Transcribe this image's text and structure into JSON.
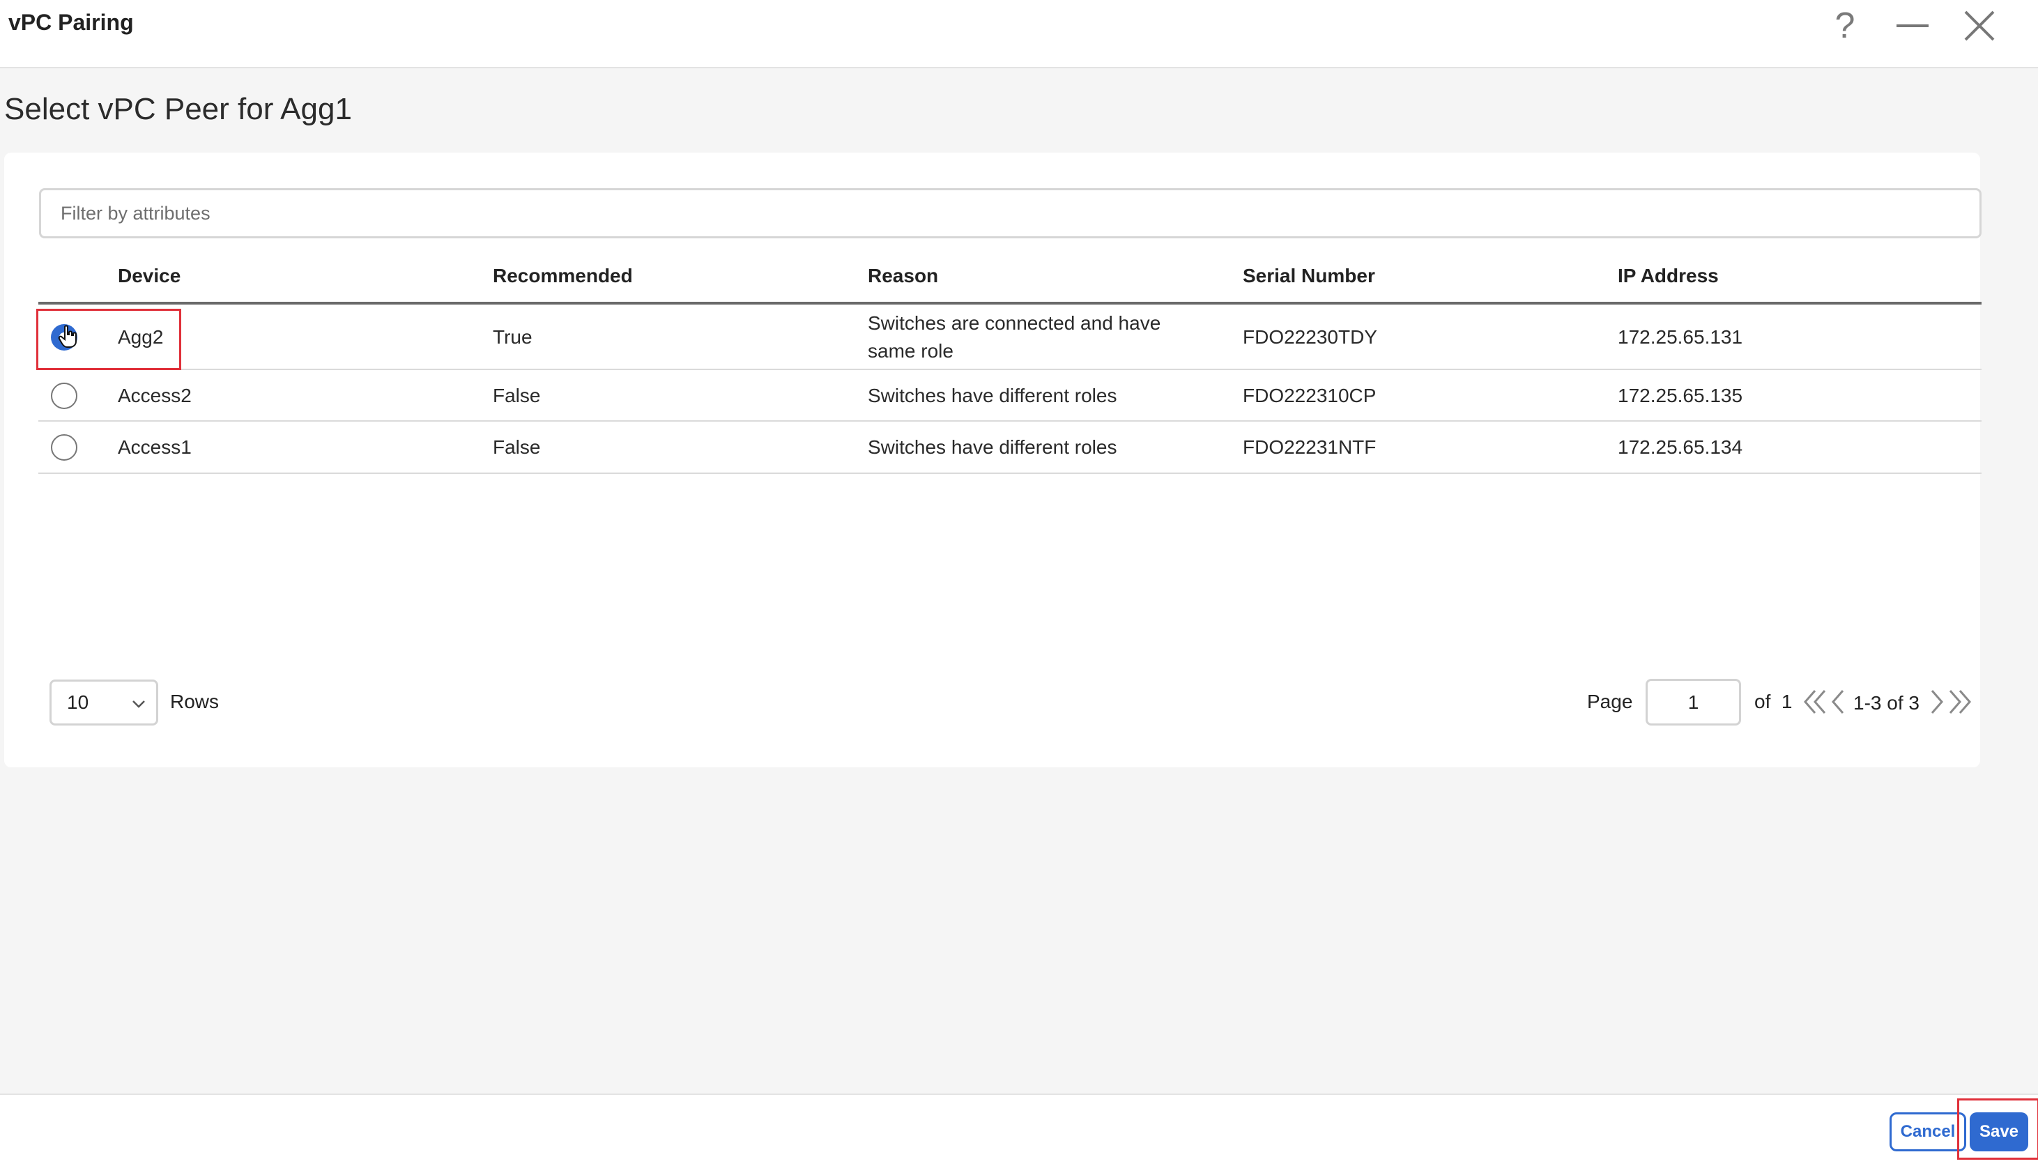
{
  "window": {
    "title": "vPC Pairing"
  },
  "page": {
    "title": "Select vPC Peer for Agg1"
  },
  "filter": {
    "placeholder": "Filter by attributes",
    "value": ""
  },
  "table": {
    "columns": [
      "Device",
      "Recommended",
      "Reason",
      "Serial Number",
      "IP Address"
    ],
    "rows": [
      {
        "selected": true,
        "device": "Agg2",
        "recommended": "True",
        "reason_line1": "Switches are connected and have",
        "reason_line2": "same role",
        "serial": "FDO22230TDY",
        "ip": "172.25.65.131"
      },
      {
        "selected": false,
        "device": "Access2",
        "recommended": "False",
        "reason_line1": "Switches have different roles",
        "serial": "FDO222310CP",
        "ip": "172.25.65.135"
      },
      {
        "selected": false,
        "device": "Access1",
        "recommended": "False",
        "reason_line1": "Switches have different roles",
        "serial": "FDO22231NTF",
        "ip": "172.25.65.134"
      }
    ]
  },
  "pagination": {
    "rows_per_page": "10",
    "rows_label": "Rows",
    "page_label": "Page",
    "current_page": "1",
    "of_label": "of",
    "total_pages": "1",
    "range": "1-3 of 3"
  },
  "footer": {
    "cancel_label": "Cancel",
    "save_label": "Save"
  },
  "colors": {
    "accent": "#2f6ad0",
    "highlight": "#e0303a"
  },
  "icons": [
    "help-icon",
    "minimize-icon",
    "close-icon",
    "chevron-down-icon",
    "first-page-icon",
    "prev-page-icon",
    "next-page-icon",
    "last-page-icon",
    "hand-cursor-icon"
  ]
}
